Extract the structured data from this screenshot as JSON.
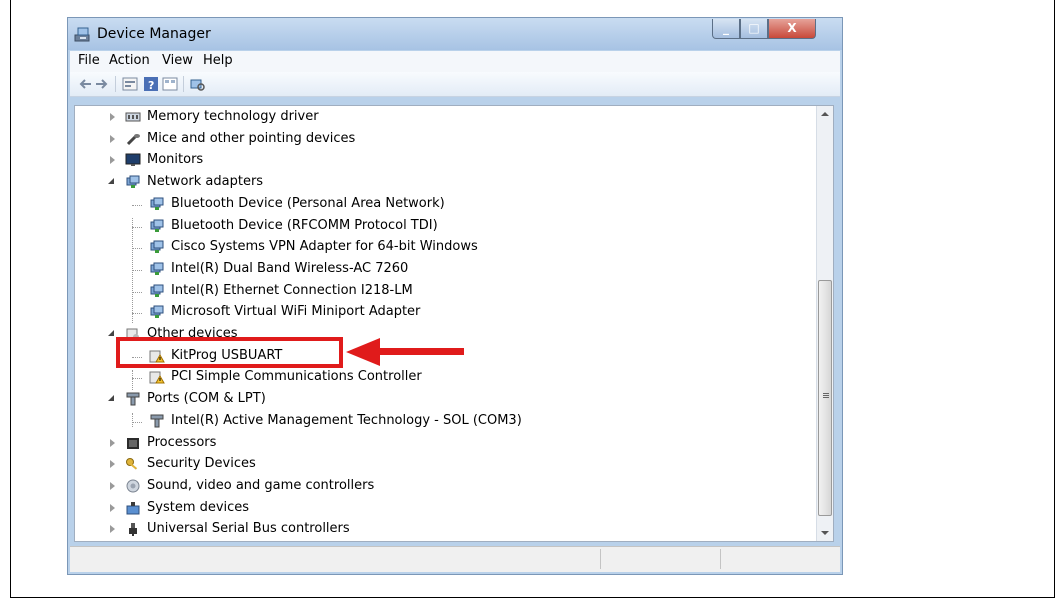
{
  "window": {
    "title": "Device Manager",
    "min_glyph": "_",
    "max_glyph": "□",
    "close_glyph": "X"
  },
  "menu": [
    "File",
    "Action",
    "View",
    "Help"
  ],
  "tree": [
    {
      "label": "Memory technology driver",
      "icon": "memory-icon",
      "expand": "collapsed"
    },
    {
      "label": "Mice and other pointing devices",
      "icon": "mouse-icon",
      "expand": "collapsed"
    },
    {
      "label": "Monitors",
      "icon": "monitor-icon",
      "expand": "collapsed"
    },
    {
      "label": "Network adapters",
      "icon": "network-adapter-icon",
      "expand": "expanded"
    },
    {
      "label": "Bluetooth Device (Personal Area Network)",
      "icon": "network-adapter-icon"
    },
    {
      "label": "Bluetooth Device (RFCOMM Protocol TDI)",
      "icon": "network-adapter-icon"
    },
    {
      "label": "Cisco Systems VPN Adapter for 64-bit Windows",
      "icon": "network-adapter-icon"
    },
    {
      "label": "Intel(R) Dual Band Wireless-AC 7260",
      "icon": "network-adapter-icon"
    },
    {
      "label": "Intel(R) Ethernet Connection I218-LM",
      "icon": "network-adapter-icon"
    },
    {
      "label": "Microsoft Virtual WiFi Miniport Adapter",
      "icon": "network-adapter-icon"
    },
    {
      "label": "Other devices",
      "icon": "other-devices-icon",
      "expand": "expanded"
    },
    {
      "label": "KitProg USBUART",
      "icon": "warning-device-icon"
    },
    {
      "label": "PCI Simple Communications Controller",
      "icon": "warning-device-icon"
    },
    {
      "label": "Ports (COM & LPT)",
      "icon": "port-icon",
      "expand": "expanded"
    },
    {
      "label": "Intel(R) Active Management Technology - SOL (COM3)",
      "icon": "port-icon"
    },
    {
      "label": "Processors",
      "icon": "processor-icon",
      "expand": "collapsed"
    },
    {
      "label": "Security Devices",
      "icon": "key-icon",
      "expand": "collapsed"
    },
    {
      "label": "Sound, video and game controllers",
      "icon": "speaker-icon",
      "expand": "collapsed"
    },
    {
      "label": "System devices",
      "icon": "system-devices-icon",
      "expand": "collapsed"
    },
    {
      "label": "Universal Serial Bus controllers",
      "icon": "usb-icon",
      "expand": "collapsed"
    }
  ],
  "annotation": {
    "highlight_color": "#e01b1b"
  }
}
